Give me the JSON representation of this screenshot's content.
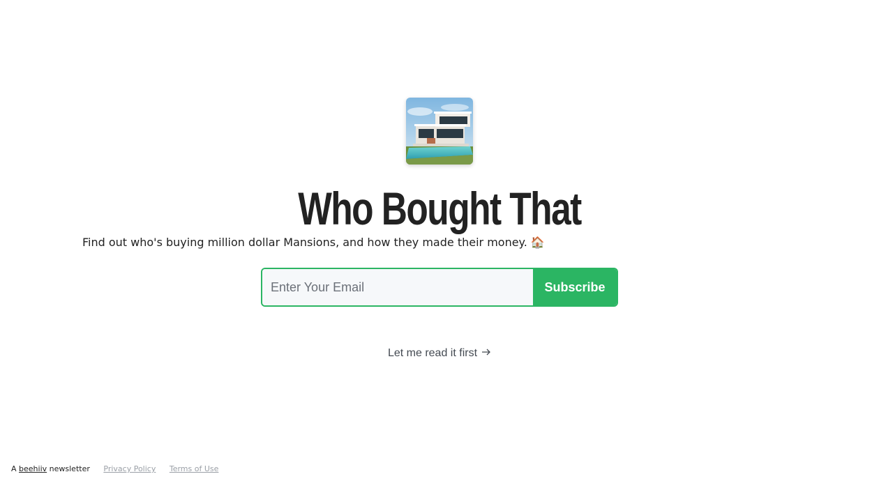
{
  "header": {
    "logo_alt": "Modern mansion with pool"
  },
  "main": {
    "title": "Who Bought That",
    "tagline": "Find out who's buying million dollar Mansions, and how they made their money.",
    "tagline_emoji": "🏠",
    "signup": {
      "placeholder": "Enter Your Email",
      "button_label": "Subscribe"
    },
    "read_first_label": "Let me read it first",
    "read_first_icon": "arrow-right-icon"
  },
  "footer": {
    "prefix": "A",
    "brand": "beehiiv",
    "suffix": "newsletter",
    "privacy": "Privacy Policy",
    "terms": "Terms of Use"
  },
  "colors": {
    "accent": "#2bb563",
    "text": "#222222",
    "muted": "#9a9fa6",
    "input_bg": "#f6f8fa"
  }
}
